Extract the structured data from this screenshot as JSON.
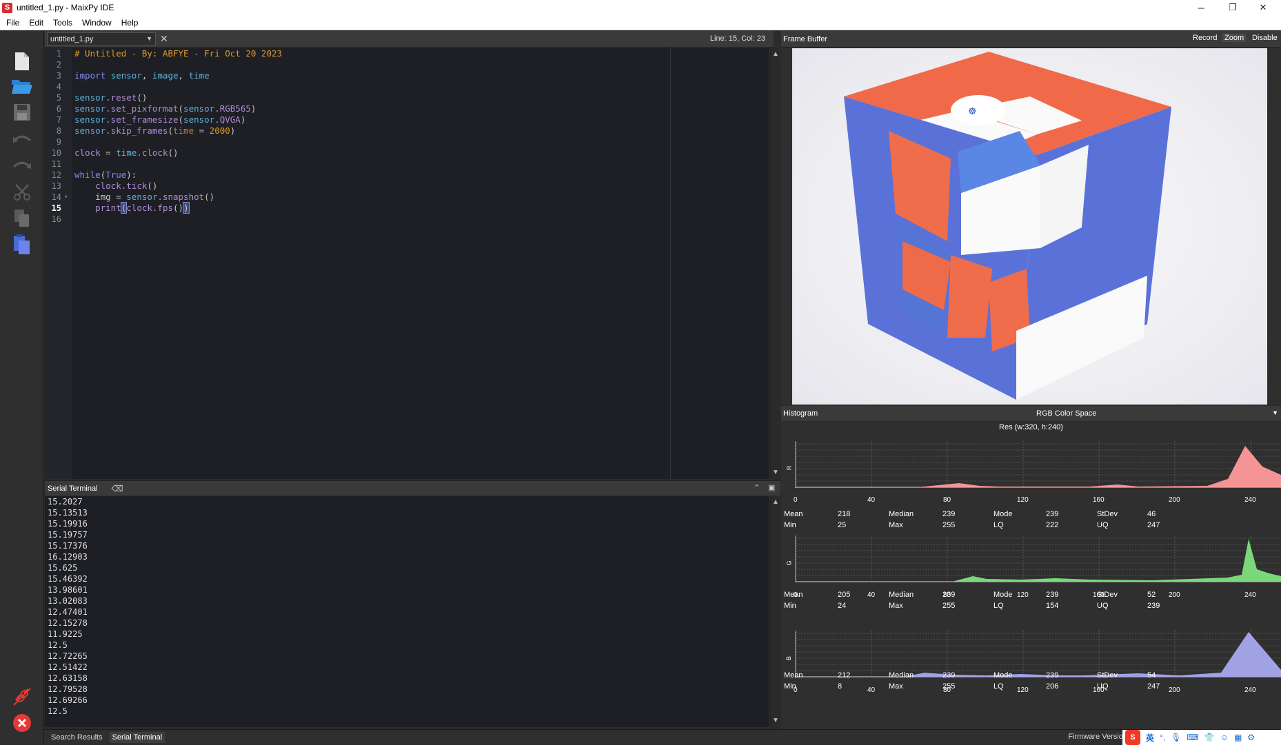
{
  "window": {
    "title": "untitled_1.py - MaixPy IDE",
    "app_icon": "S",
    "controls": [
      "─",
      "❐",
      "✕"
    ]
  },
  "menu": [
    "File",
    "Edit",
    "Tools",
    "Window",
    "Help"
  ],
  "editor": {
    "file_name": "untitled_1.py",
    "cursor_status": "Line: 15, Col: 23",
    "current_line": 15,
    "line_numbers": [
      "1",
      "2",
      "3",
      "4",
      "5",
      "6",
      "7",
      "8",
      "9",
      "10",
      "11",
      "12",
      "13",
      "14",
      "15",
      "16"
    ]
  },
  "terminal": {
    "title": "Serial Terminal",
    "lines": [
      "15.2027",
      "15.13513",
      "15.19916",
      "15.19757",
      "15.17376",
      "16.12903",
      "15.625",
      "15.46392",
      "13.98601",
      "13.02083",
      "12.47401",
      "12.15278",
      "11.9225",
      "12.5",
      "12.72265",
      "12.51422",
      "12.63158",
      "12.79528",
      "12.69266",
      "12.5"
    ]
  },
  "bottom_tabs": [
    "Search Results",
    "Serial Terminal"
  ],
  "status": {
    "firmware": "Firmware Version:"
  },
  "tray": {
    "ime_lang": "英"
  },
  "frame_buffer": {
    "title": "Frame Buffer",
    "buttons": [
      "Record",
      "Zoom",
      "Disable"
    ]
  },
  "histogram": {
    "title": "Histogram",
    "color_space": "RGB Color Space",
    "resolution": "Res (w:320, h:240)",
    "x_ticks": [
      "0",
      "40",
      "80",
      "120",
      "160",
      "200",
      "240"
    ],
    "channels": [
      {
        "label": "R",
        "color": "#ff9a9a",
        "stats": {
          "Mean": "218",
          "Median": "239",
          "Mode": "239",
          "StDev": "46",
          "Min": "25",
          "Max": "255",
          "LQ": "222",
          "UQ": "247"
        }
      },
      {
        "label": "G",
        "color": "#7ee07e",
        "stats": {
          "Mean": "205",
          "Median": "239",
          "Mode": "239",
          "StDev": "52",
          "Min": "24",
          "Max": "255",
          "LQ": "154",
          "UQ": "239"
        }
      },
      {
        "label": "B",
        "color": "#a8a8f0",
        "stats": {
          "Mean": "212",
          "Median": "239",
          "Mode": "239",
          "StDev": "54",
          "Min": "8",
          "Max": "255",
          "LQ": "206",
          "UQ": "247"
        }
      }
    ]
  }
}
